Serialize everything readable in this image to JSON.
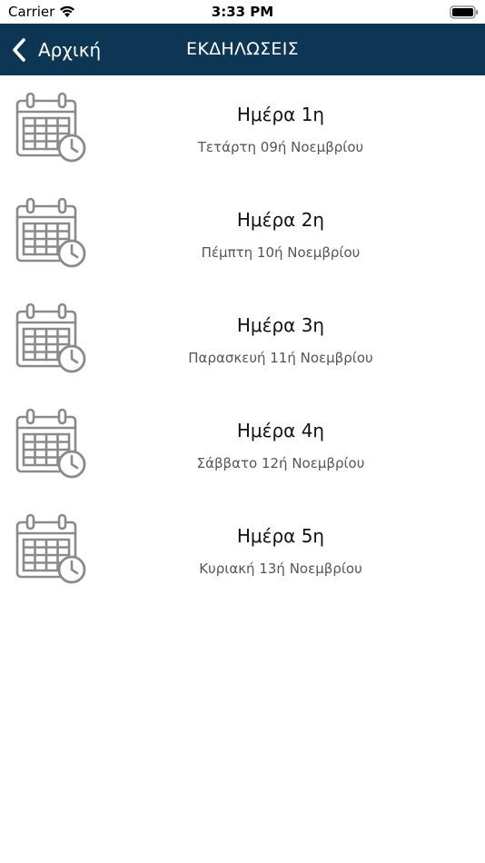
{
  "status_bar": {
    "carrier": "Carrier",
    "time": "3:33 PM"
  },
  "nav": {
    "back_label": "Αρχική",
    "title": "ΕΚΔΗΛΩΣΕΙΣ",
    "background_color": "#0d3654"
  },
  "days": [
    {
      "title": "Ημέρα 1η",
      "date": "Τετάρτη 09ή Νοεμβρίου",
      "icon": "calendar-clock-icon"
    },
    {
      "title": "Ημέρα 2η",
      "date": "Πέμπτη 10ή Νοεμβρίου",
      "icon": "calendar-clock-icon"
    },
    {
      "title": "Ημέρα 3η",
      "date": "Παρασκευή 11ή Νοεμβρίου",
      "icon": "calendar-clock-icon"
    },
    {
      "title": "Ημέρα 4η",
      "date": "Σάββατο 12ή Νοεμβρίου",
      "icon": "calendar-clock-icon"
    },
    {
      "title": "Ημέρα 5η",
      "date": "Κυριακή 13ή Νοεμβρίου",
      "icon": "calendar-clock-icon"
    }
  ]
}
